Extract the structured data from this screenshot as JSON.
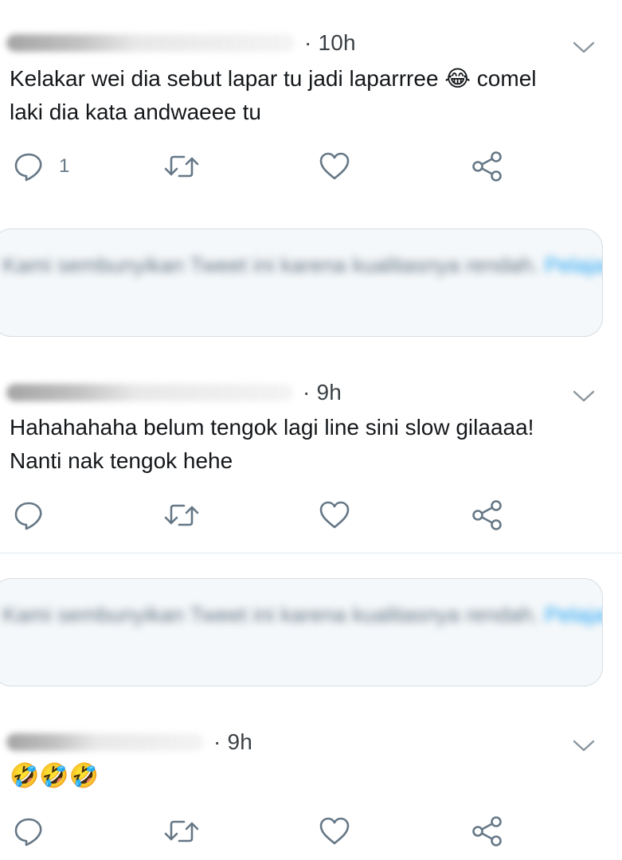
{
  "tweets": [
    {
      "time": "· 10h",
      "text": "Kelakar wei dia sebut lapar tu jadi laparrree 😂 comel\nlaki dia kata andwaeee tu",
      "reply_count": "1"
    },
    {
      "time": "· 9h",
      "text": "Hahahahaha belum tengok lagi line sini slow gilaaaa!\nNanti nak tengok hehe",
      "reply_count": ""
    },
    {
      "time": "· 9h",
      "text": "🤣🤣🤣",
      "reply_count": ""
    }
  ],
  "notices": [
    {
      "text": "Kami sembunyikan Tweet ini karena kualitasnya rendah.",
      "link": "Pelajari"
    },
    {
      "text": "Kami sembunyikan Tweet ini karena kualitasnya rendah.",
      "link": "Pelajari"
    }
  ],
  "colors": {
    "text": "#14171a",
    "muted": "#657786",
    "icon": "#657786",
    "border": "#e1e8ed",
    "notice_bg": "#f5f8fa",
    "link": "#1da1f2"
  },
  "icons": [
    "reply-icon",
    "retweet-icon",
    "like-icon",
    "share-icon",
    "chevron-down-icon"
  ]
}
